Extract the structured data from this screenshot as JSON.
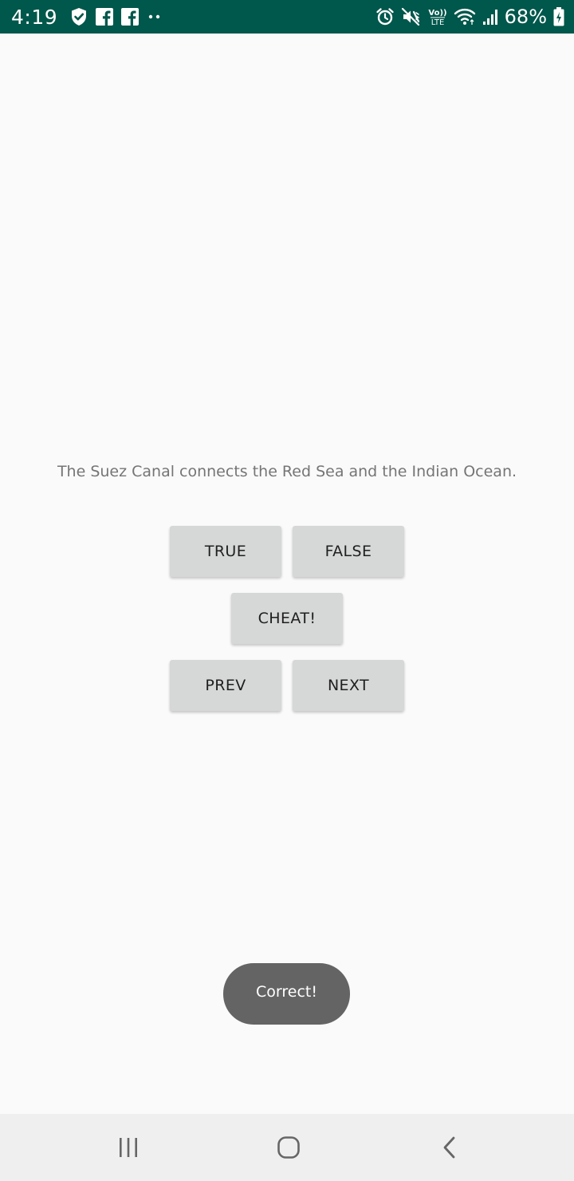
{
  "status_bar": {
    "time": "4:19",
    "battery": "68%",
    "left_icons": [
      "shield-check-icon",
      "facebook-icon",
      "facebook-icon",
      "more-dots-icon"
    ],
    "right_icons": [
      "alarm-icon",
      "vibrate-mute-icon",
      "volte-icon",
      "wifi-icon",
      "signal-icon",
      "battery-charging-icon"
    ],
    "background_color": "#00574b"
  },
  "quiz": {
    "question": "The Suez Canal connects the Red Sea and the Indian Ocean.",
    "buttons": {
      "true_label": "TRUE",
      "false_label": "FALSE",
      "cheat_label": "CHEAT!",
      "prev_label": "PREV",
      "next_label": "NEXT"
    }
  },
  "toast": {
    "message": "Correct!"
  },
  "nav_bar": {
    "icons": [
      "recents-icon",
      "home-icon",
      "back-icon"
    ]
  }
}
